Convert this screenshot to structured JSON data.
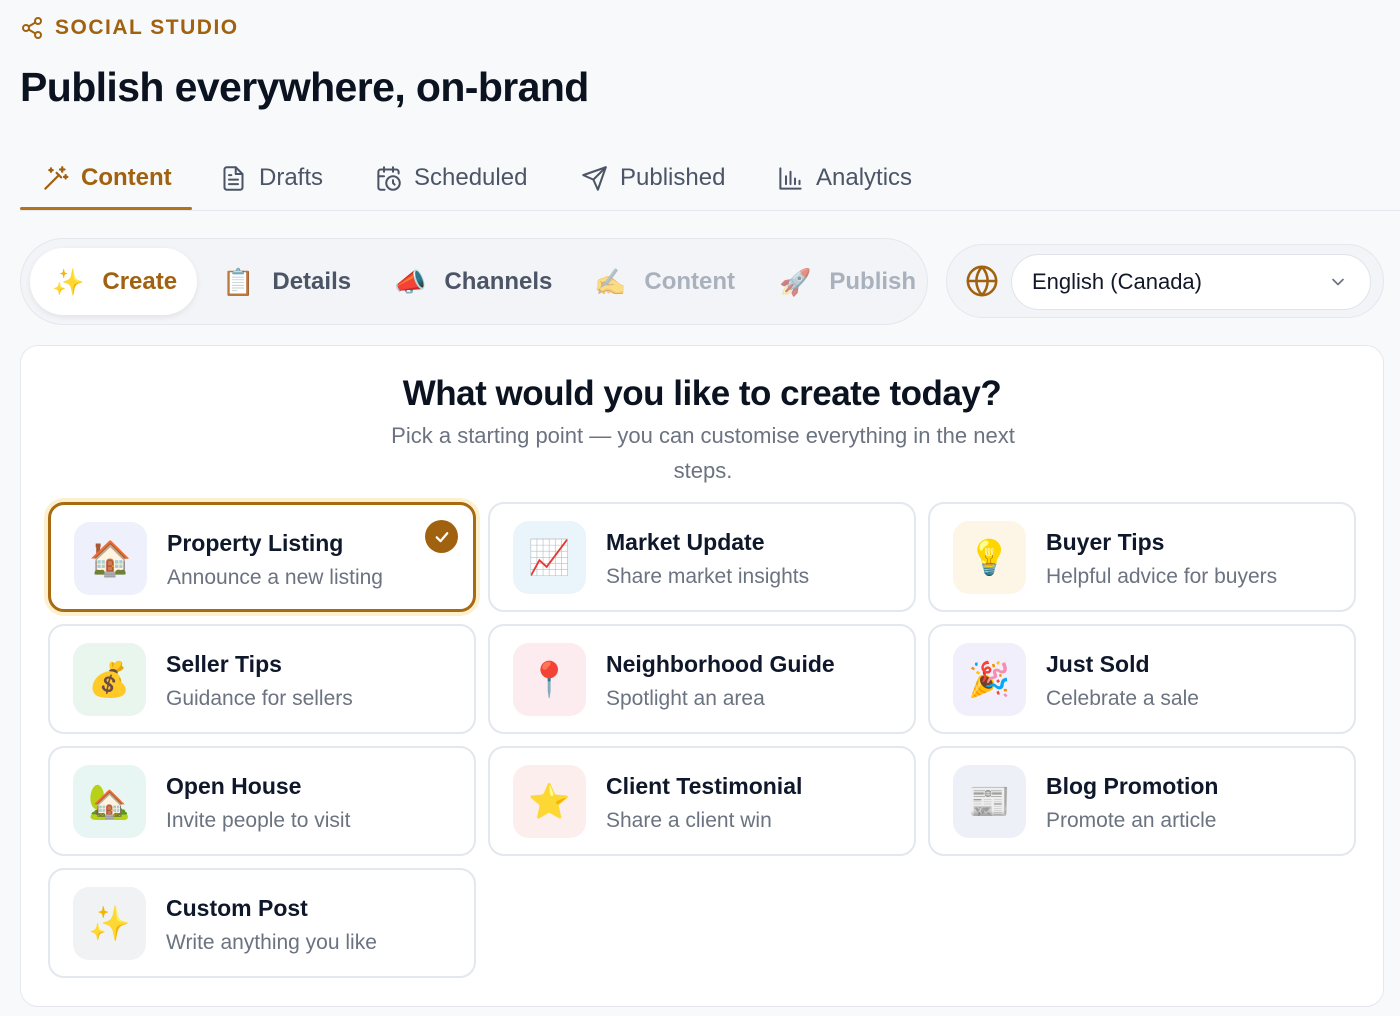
{
  "brand": {
    "name": "SOCIAL STUDIO",
    "icon": "share-icon",
    "color": "#a1620f"
  },
  "page": {
    "title": "Publish everywhere, on-brand"
  },
  "tabs": [
    {
      "label": "Content",
      "icon": "magic-wand-icon",
      "active": true
    },
    {
      "label": "Drafts",
      "icon": "document-icon"
    },
    {
      "label": "Scheduled",
      "icon": "calendar-clock-icon"
    },
    {
      "label": "Published",
      "icon": "paper-plane-icon"
    },
    {
      "label": "Analytics",
      "icon": "bar-chart-icon"
    }
  ],
  "stepper": [
    {
      "label": "Create",
      "emoji": "✨",
      "state": "active"
    },
    {
      "label": "Details",
      "emoji": "📋",
      "state": "enabled"
    },
    {
      "label": "Channels",
      "emoji": "📣",
      "state": "enabled"
    },
    {
      "label": "Content",
      "emoji": "✍️",
      "state": "disabled"
    },
    {
      "label": "Publish",
      "emoji": "🚀",
      "state": "disabled"
    }
  ],
  "language": {
    "icon": "globe-icon",
    "selected": "English (Canada)"
  },
  "main": {
    "title": "What would you like to create today?",
    "subtitle": "Pick a starting point — you can customise everything in the next steps.",
    "options": [
      {
        "title": "Property Listing",
        "desc": "Announce a new listing",
        "emoji": "🏠",
        "bg": "#eef0fb",
        "selected": true
      },
      {
        "title": "Market Update",
        "desc": "Share market insights",
        "emoji": "📈",
        "bg": "#e9f4fb"
      },
      {
        "title": "Buyer Tips",
        "desc": "Helpful advice for buyers",
        "emoji": "💡",
        "bg": "#fdf6e7"
      },
      {
        "title": "Seller Tips",
        "desc": "Guidance for sellers",
        "emoji": "💰",
        "bg": "#e8f6ee"
      },
      {
        "title": "Neighborhood Guide",
        "desc": "Spotlight an area",
        "emoji": "📍",
        "bg": "#fdecef"
      },
      {
        "title": "Just Sold",
        "desc": "Celebrate a sale",
        "emoji": "🎉",
        "bg": "#f1effb"
      },
      {
        "title": "Open House",
        "desc": "Invite people to visit",
        "emoji": "🏡",
        "bg": "#e7f6f2"
      },
      {
        "title": "Client Testimonial",
        "desc": "Share a client win",
        "emoji": "⭐",
        "bg": "#fdeeee"
      },
      {
        "title": "Blog Promotion",
        "desc": "Promote an article",
        "emoji": "📰",
        "bg": "#eef0f8"
      },
      {
        "title": "Custom Post",
        "desc": "Write anything you like",
        "emoji": "✨",
        "bg": "#f1f2f4"
      }
    ]
  }
}
